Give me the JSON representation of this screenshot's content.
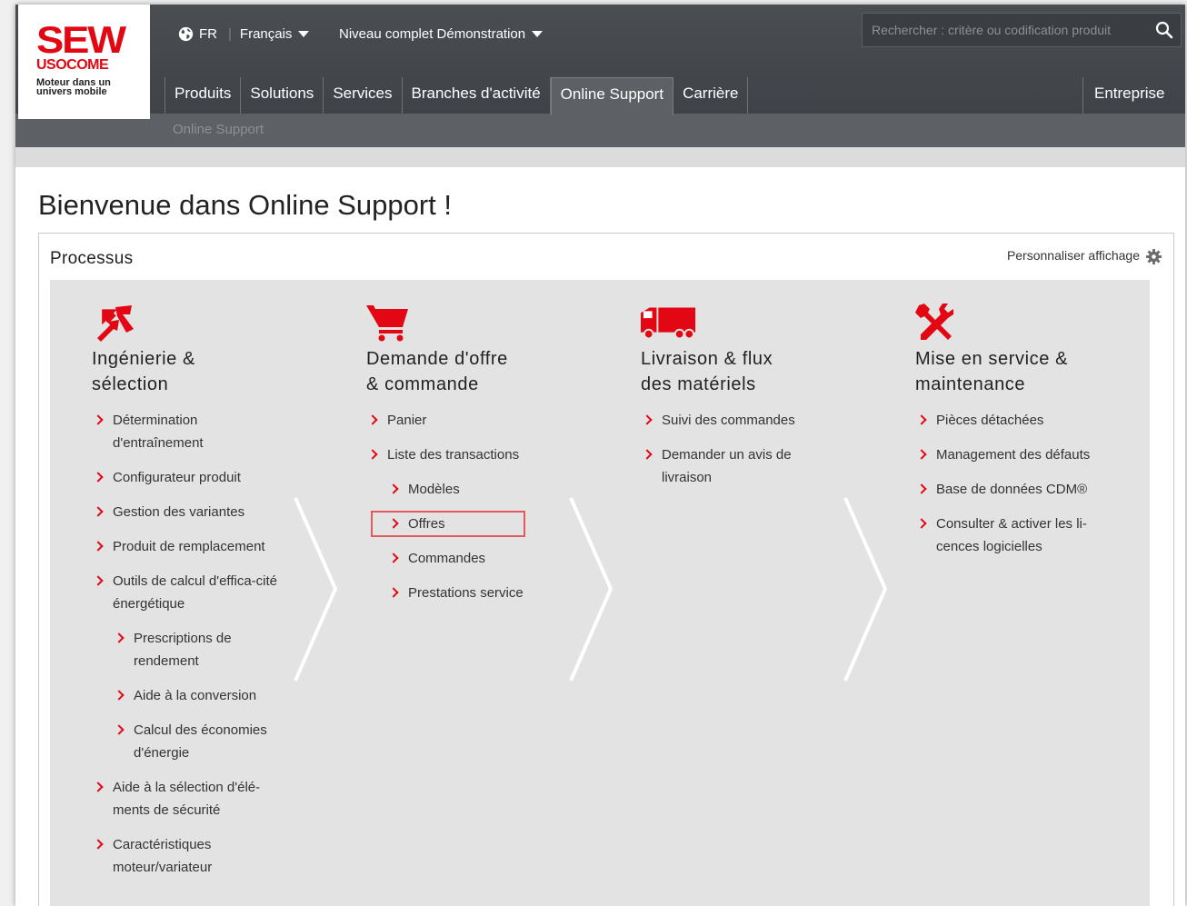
{
  "brand": {
    "name": "SEW",
    "sub": "USOCOME",
    "tagline_1": "Moteur dans un",
    "tagline_2": "univers mobile",
    "accent": "#e30613"
  },
  "topbar": {
    "country": "FR",
    "language": "Français",
    "level": "Niveau complet Démonstration",
    "search_placeholder": "Rechercher : critère ou codification produit"
  },
  "nav": {
    "items": [
      "Produits",
      "Solutions",
      "Services",
      "Branches d'activité",
      "Online Support",
      "Carrière"
    ],
    "active_index": 4,
    "right": "Entreprise"
  },
  "subnav": {
    "label": "Online Support"
  },
  "page": {
    "title": "Bienvenue dans Online Support !"
  },
  "panel": {
    "title": "Processus",
    "customize": "Personnaliser affichage"
  },
  "columns": [
    {
      "icon": "engineering-icon",
      "title_1": "Ingénierie &",
      "title_2": "sélection",
      "items": [
        {
          "label": "Détermination d'entraînement",
          "level": 1
        },
        {
          "label": "Configurateur produit",
          "level": 1
        },
        {
          "label": "Gestion des variantes",
          "level": 1
        },
        {
          "label": "Produit de remplacement",
          "level": 1
        },
        {
          "label": "Outils de calcul d'effica-cité énergétique",
          "level": 1
        },
        {
          "label": "Prescriptions de rendement",
          "level": 2
        },
        {
          "label": "Aide à la conversion",
          "level": 2
        },
        {
          "label": "Calcul des économies d'énergie",
          "level": 2
        },
        {
          "label": "Aide à la sélection d'élé-ments de sécurité",
          "level": 1
        },
        {
          "label": "Caractéristiques moteur/variateur",
          "level": 1
        }
      ]
    },
    {
      "icon": "cart-icon",
      "title_1": "Demande d'offre",
      "title_2": "& commande",
      "items": [
        {
          "label": "Panier",
          "level": 1
        },
        {
          "label": "Liste des transactions",
          "level": 1
        },
        {
          "label": "Modèles",
          "level": 2
        },
        {
          "label": "Offres",
          "level": 2,
          "highlighted": true
        },
        {
          "label": "Commandes",
          "level": 2
        },
        {
          "label": "Prestations service",
          "level": 2
        }
      ]
    },
    {
      "icon": "truck-icon",
      "title_1": "Livraison & flux",
      "title_2": "des matériels",
      "items": [
        {
          "label": "Suivi des commandes",
          "level": 1
        },
        {
          "label": "Demander un avis de livraison",
          "level": 1
        }
      ]
    },
    {
      "icon": "tools-icon",
      "title_1": "Mise en service &",
      "title_2": "maintenance",
      "items": [
        {
          "label": "Pièces détachées",
          "level": 1
        },
        {
          "label": "Management des défauts",
          "level": 1
        },
        {
          "label": "Base de données CDM®",
          "level": 1
        },
        {
          "label": "Consulter & activer les li-cences logicielles",
          "level": 1
        }
      ]
    }
  ]
}
